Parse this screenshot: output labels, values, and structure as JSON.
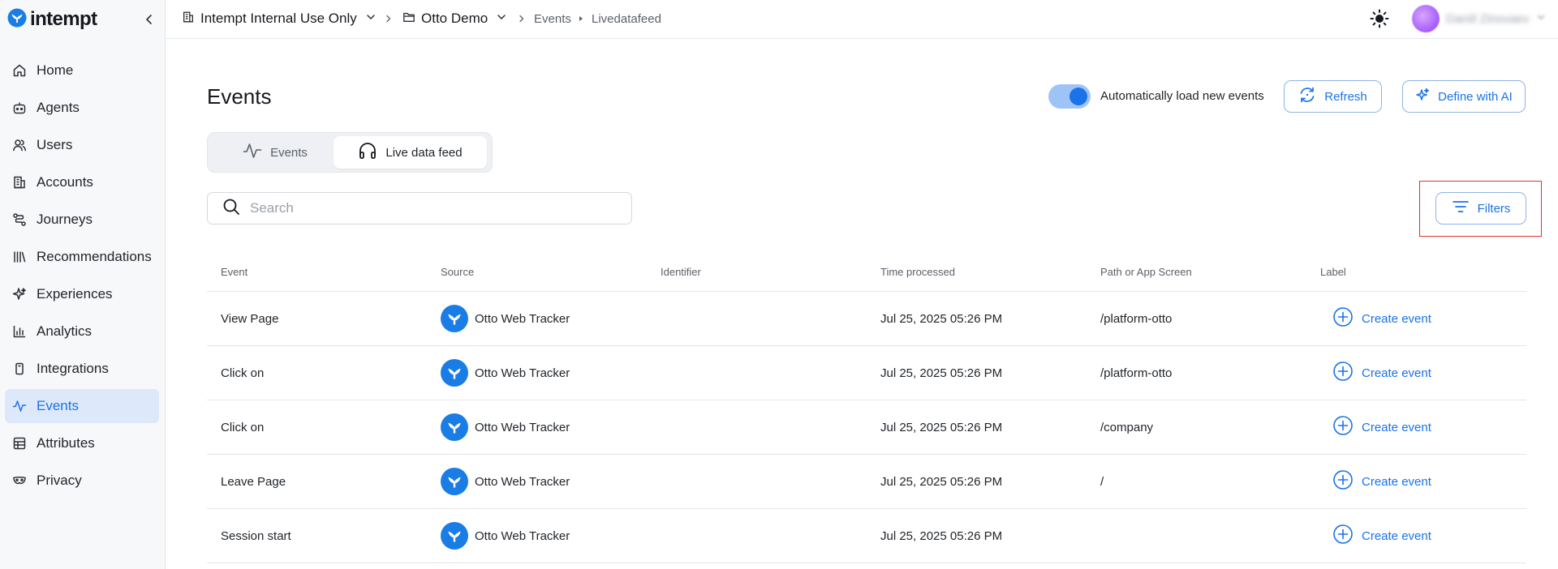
{
  "app": {
    "logo_text": "intempt",
    "accent_color": "#1a73e8"
  },
  "sidebar": {
    "items": [
      {
        "label": "Home",
        "icon": "home-icon"
      },
      {
        "label": "Agents",
        "icon": "robot-icon"
      },
      {
        "label": "Users",
        "icon": "users-icon"
      },
      {
        "label": "Accounts",
        "icon": "building-icon"
      },
      {
        "label": "Journeys",
        "icon": "journey-icon"
      },
      {
        "label": "Recommendations",
        "icon": "library-icon"
      },
      {
        "label": "Experiences",
        "icon": "sparkle-icon"
      },
      {
        "label": "Analytics",
        "icon": "bar-chart-icon"
      },
      {
        "label": "Integrations",
        "icon": "plug-icon"
      },
      {
        "label": "Events",
        "icon": "activity-icon",
        "active": true
      },
      {
        "label": "Attributes",
        "icon": "table-icon"
      },
      {
        "label": "Privacy",
        "icon": "mask-icon"
      }
    ]
  },
  "topbar": {
    "org": "Intempt Internal Use Only",
    "project": "Otto Demo",
    "crumb_section": "Events",
    "crumb_page": "Livedatafeed",
    "user_name": "Daniil Zinovaev"
  },
  "page": {
    "title": "Events",
    "auto_load_label": "Automatically load new events",
    "auto_load_on": true,
    "refresh_label": "Refresh",
    "define_label": "Define with AI",
    "filters_label": "Filters"
  },
  "tabs": {
    "events_label": "Events",
    "live_label": "Live data feed"
  },
  "search": {
    "placeholder": "Search",
    "value": ""
  },
  "table": {
    "columns": {
      "event": "Event",
      "source": "Source",
      "identifier": "Identifier",
      "time": "Time processed",
      "path": "Path or App Screen",
      "label": "Label"
    },
    "rows": [
      {
        "event": "View Page",
        "source": "Otto Web Tracker",
        "identifier": "",
        "time": "Jul 25, 2025 05:26 PM",
        "path": "/platform-otto",
        "label": "Create event"
      },
      {
        "event": "Click on",
        "source": "Otto Web Tracker",
        "identifier": "",
        "time": "Jul 25, 2025 05:26 PM",
        "path": "/platform-otto",
        "label": "Create event"
      },
      {
        "event": "Click on",
        "source": "Otto Web Tracker",
        "identifier": "",
        "time": "Jul 25, 2025 05:26 PM",
        "path": "/company",
        "label": "Create event"
      },
      {
        "event": "Leave Page",
        "source": "Otto Web Tracker",
        "identifier": "",
        "time": "Jul 25, 2025 05:26 PM",
        "path": "/",
        "label": "Create event"
      },
      {
        "event": "Session start",
        "source": "Otto Web Tracker",
        "identifier": "",
        "time": "Jul 25, 2025 05:26 PM",
        "path": "",
        "label": "Create event"
      }
    ]
  }
}
